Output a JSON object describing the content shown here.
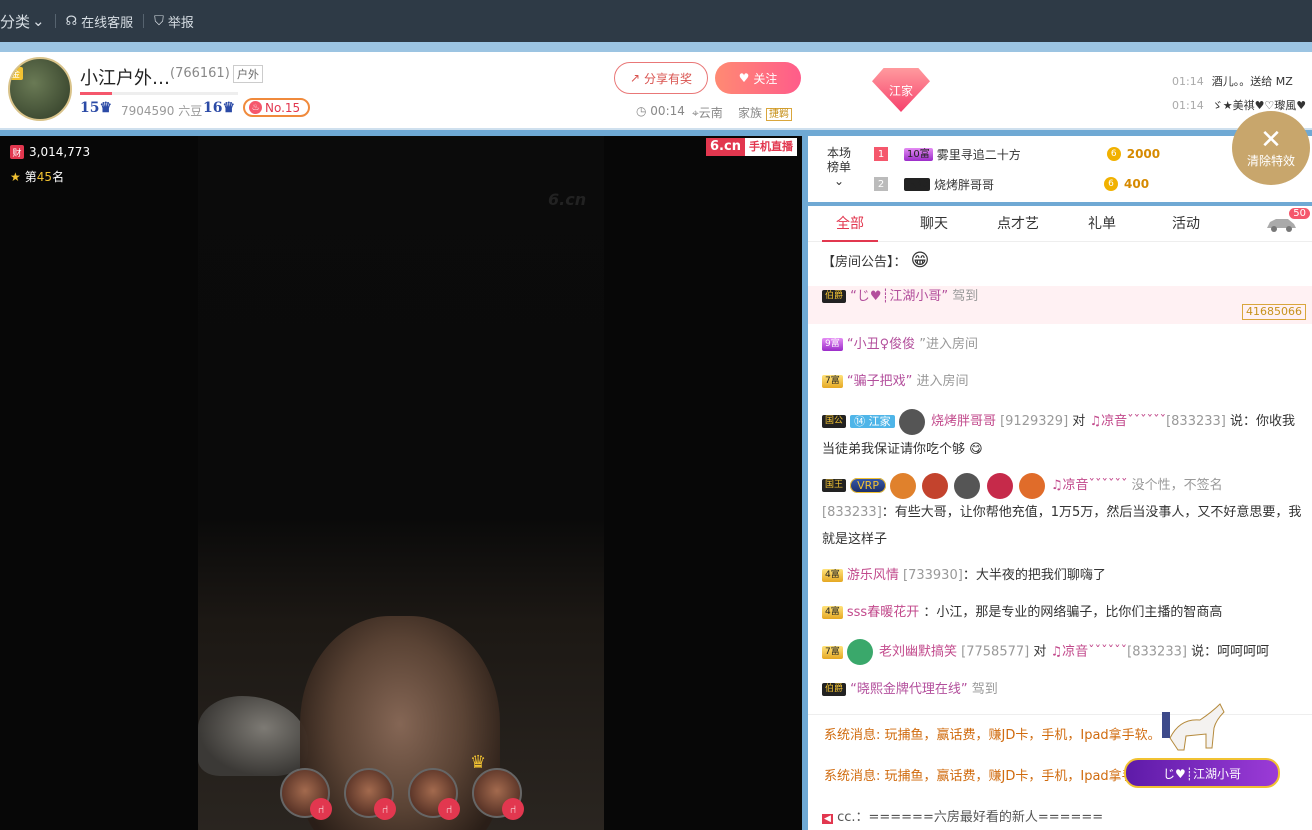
{
  "topbar": {
    "category": "分类",
    "service": "在线客服",
    "report": "举报"
  },
  "header": {
    "badge": "金",
    "name": "小江户外…",
    "room_id": "(766161)",
    "tag": "户外",
    "level1": "15",
    "beans": "7904590 六豆",
    "level2": "16",
    "rank": "No.15",
    "share": "分享有奖",
    "follow": "关注",
    "timer": "00:14",
    "location": "云南",
    "family": "家族",
    "family_tag": "捷羁",
    "family_badge": "江家",
    "ticker": [
      {
        "time": "01:14",
        "text": "酒儿。。送给 MZ"
      },
      {
        "time": "01:14",
        "text": "ゞ★美祺♥♡瓈風♥"
      }
    ]
  },
  "video": {
    "logo_a": "6.cn",
    "logo_b": "手机直播",
    "watermark": "6.cn",
    "stat": "3,014,773",
    "stat_icon": "财",
    "rank_pre": "第",
    "rank_num": "45",
    "rank_post": "名"
  },
  "ranking": {
    "label": "本场榜单",
    "rows": [
      {
        "n": "1",
        "level": "10富",
        "name": "雾里寻追二十方",
        "amount": "2000"
      },
      {
        "n": "2",
        "level": "国公",
        "name": "烧烤胖哥哥",
        "amount": "400"
      }
    ],
    "clear": "清除特效"
  },
  "tabs": [
    "全部",
    "聊天",
    "点才艺",
    "礼单",
    "活动"
  ],
  "car_count": "50",
  "chat": {
    "notice": "【房间公告】：",
    "m1": {
      "lv": "伯爵",
      "nick": "“じ♥┊江湖小哥”",
      "act": "驾到",
      "num": "41685066"
    },
    "m2": {
      "lv": "9富",
      "nick": "“小丑♀俊俊",
      "act": "”进入房间"
    },
    "m3": {
      "lv": "7富",
      "nick": "“骗子把戏”",
      "act": "进入房间"
    },
    "m4": {
      "lv": "国公",
      "fam": "⑭ 江家",
      "nick": "烧烤胖哥哥",
      "id": "[9129329]",
      "to": "对",
      "to_nick": "♫凉音ˇˇˇˇˇˇ",
      "to_id": "[833233]",
      "say": "说：你收我当徒弟我保证请你吃个够"
    },
    "m5": {
      "lv": "国王",
      "vip": "VRP",
      "nick": "♫凉音ˇˇˇˇˇˇ",
      "sign": "没个性，不签名",
      "id": "[833233]",
      "text": "：有些大哥，让你帮他充值，1万5万，然后当没事人，又不好意思要，我就是这样子"
    },
    "m6": {
      "lv": "4富",
      "nick": "游乐风情",
      "id": "[733930]",
      "text": "：大半夜的把我们聊嗨了"
    },
    "m7": {
      "lv": "4富",
      "nick": "sss春暖花开",
      "text": "：小江，那是专业的网络骗子，比你们主播的智商高"
    },
    "m8": {
      "lv": "7富",
      "nick": "老刘幽默搞笑",
      "id": "[7758577]",
      "to": "对",
      "to_nick": "♫凉音ˇˇˇˇˇˇ",
      "to_id": "[833233]",
      "say": "说：呵呵呵呵"
    },
    "m9": {
      "lv": "伯爵",
      "nick": "“晓熙金牌代理在线”",
      "act": "驾到"
    }
  },
  "system": [
    {
      "label": "系统消息:",
      "text": "玩捕鱼，赢话费，赚JD卡，手机，Ipad拿手软。"
    },
    {
      "label": "系统消息:",
      "text": "玩捕鱼，赢话费，赚JD卡，手机，Ipad拿手"
    }
  ],
  "horse_name": "じ♥┊江湖小哥",
  "bottom": "cc.：======六房最好看的新人======"
}
